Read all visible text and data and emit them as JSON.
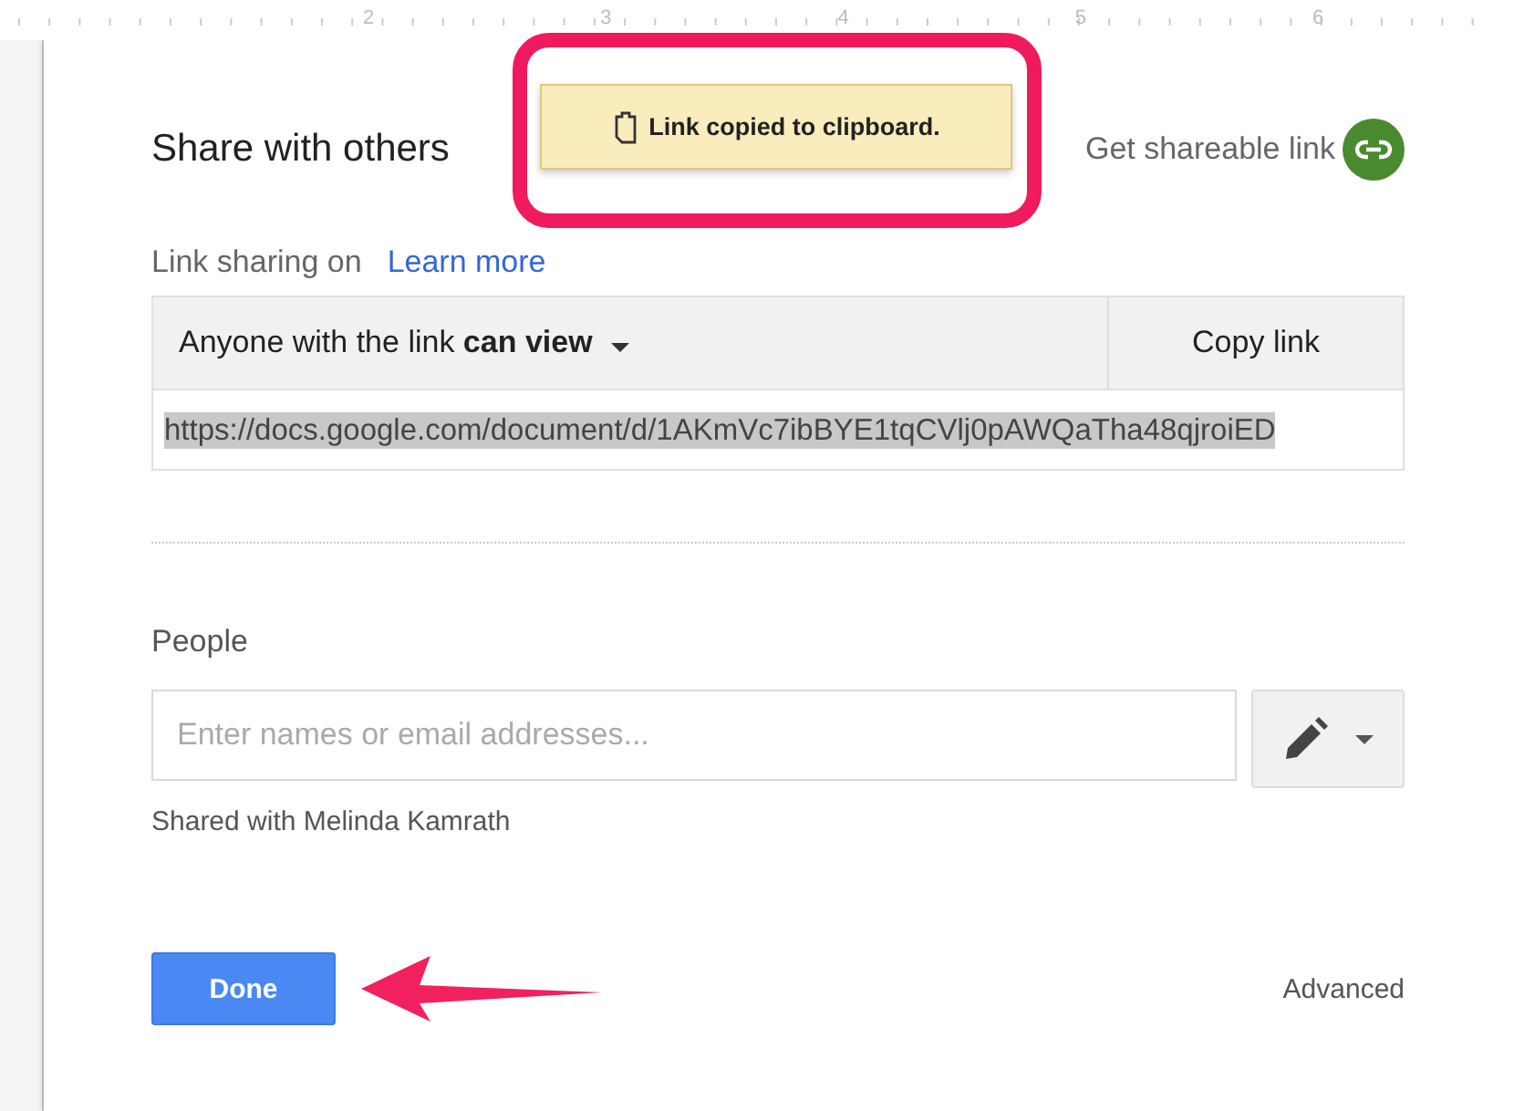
{
  "ruler": {
    "labels": [
      "2",
      "3",
      "4",
      "5",
      "6"
    ]
  },
  "dialog": {
    "title": "Share with others",
    "shareable_link": {
      "label": "Get shareable link"
    },
    "link_sharing": {
      "label": "Link sharing on",
      "learn_more": "Learn more",
      "access": "Anyone with the link **can view**",
      "copy_button": "Copy link",
      "url": "https://docs.google.com/document/d/1AKmVc7ibBYE1tqCVlj0pAWQaTha48qjroiED",
      "url_selected": true
    },
    "people": {
      "label": "People",
      "placeholder": "Enter names or email addresses...",
      "shared_with": "Shared with Melinda Kamrath"
    },
    "done_button": "Done",
    "advanced": "Advanced"
  },
  "toast": {
    "message": "Link copied to clipboard."
  }
}
